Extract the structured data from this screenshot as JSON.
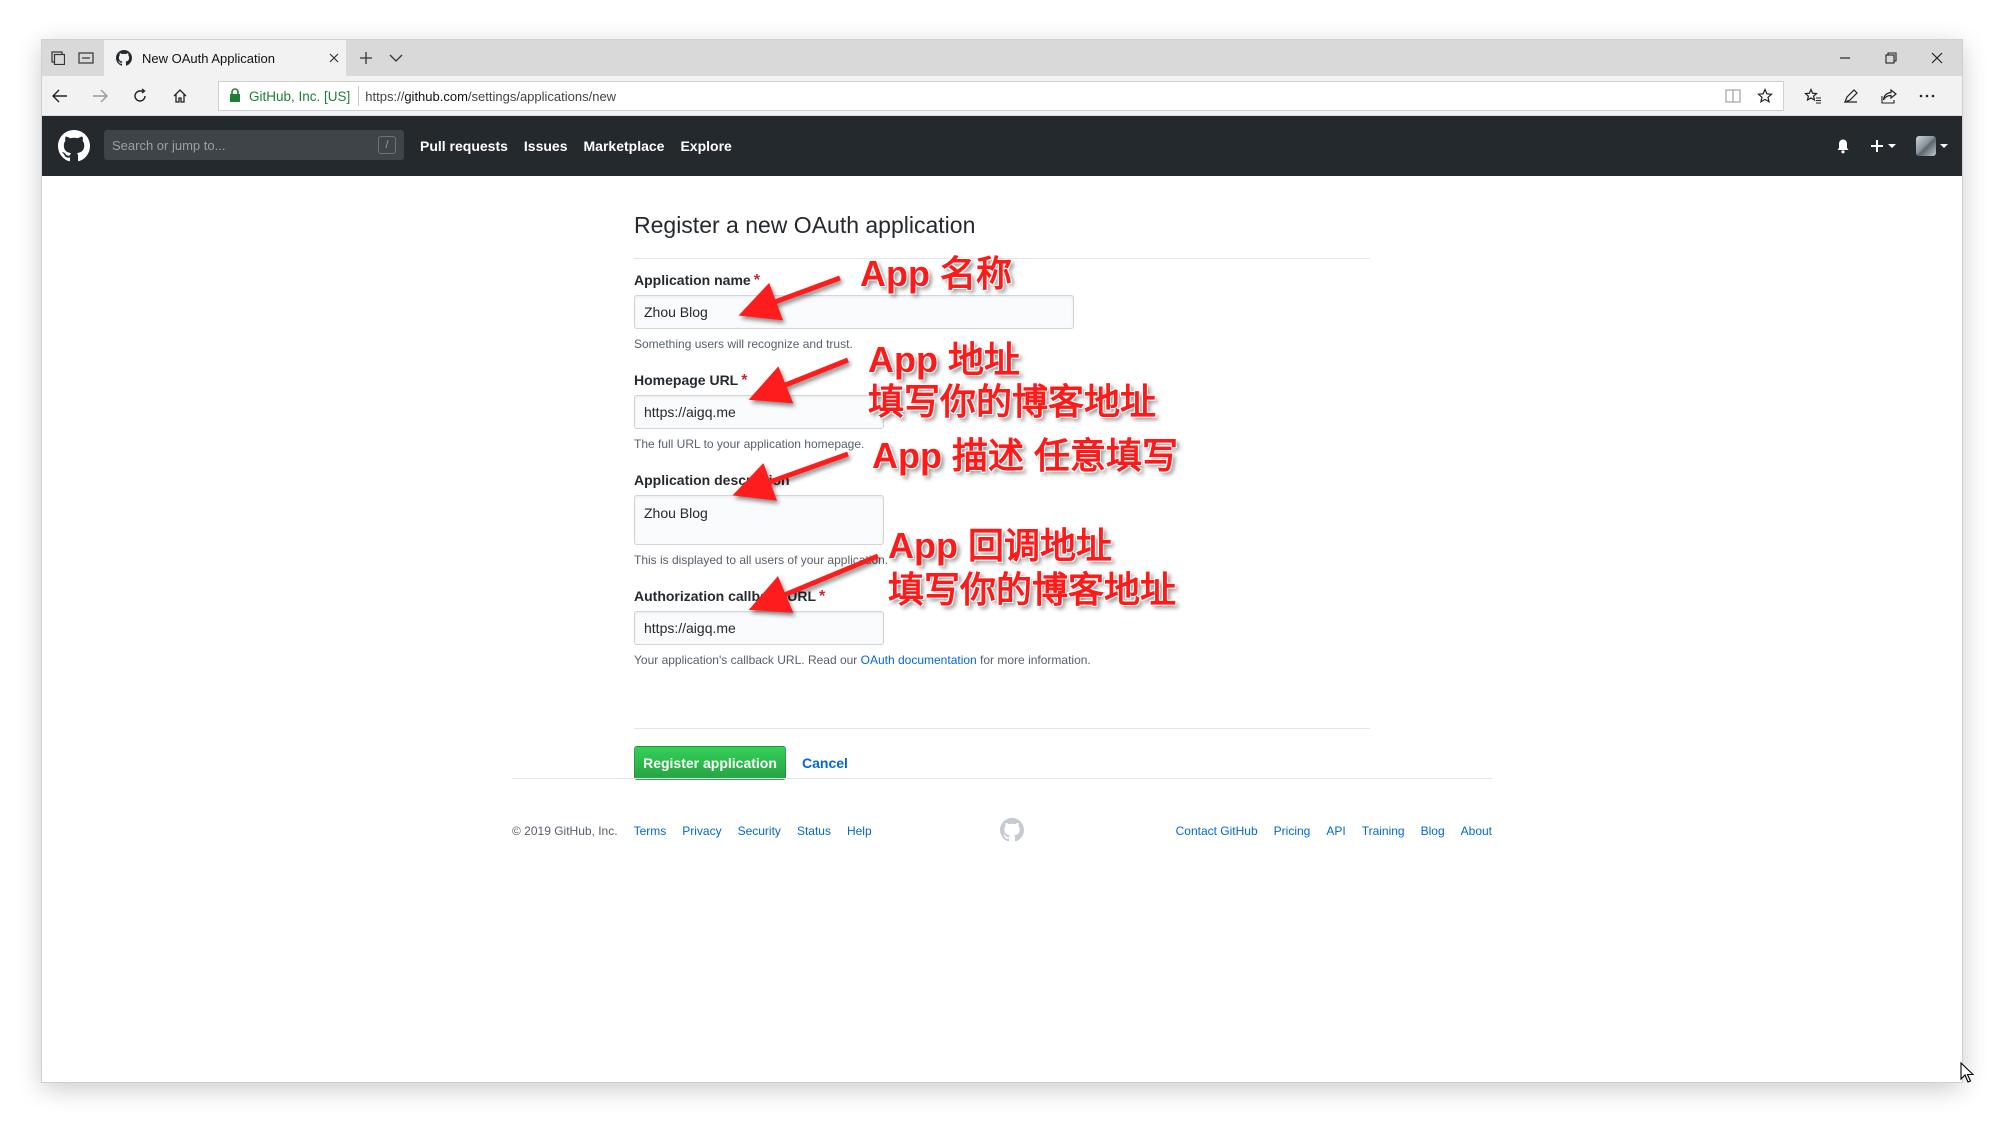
{
  "browser": {
    "tab_title": "New OAuth Application",
    "cert_label": "GitHub, Inc. [US]",
    "url_prefix": "https://",
    "url_domain": "github.com",
    "url_path": "/settings/applications/new"
  },
  "header": {
    "search_placeholder": "Search or jump to...",
    "search_shortcut": "/",
    "nav": [
      "Pull requests",
      "Issues",
      "Marketplace",
      "Explore"
    ]
  },
  "form": {
    "title": "Register a new OAuth application",
    "required_mark": "*",
    "app_name": {
      "label": "Application name",
      "value": "Zhou Blog",
      "note": "Something users will recognize and trust."
    },
    "homepage": {
      "label": "Homepage URL",
      "value": "https://aigq.me",
      "note": "The full URL to your application homepage."
    },
    "description": {
      "label": "Application description",
      "value": "Zhou Blog",
      "note": "This is displayed to all users of your application."
    },
    "callback": {
      "label": "Authorization callback URL",
      "value": "https://aigq.me",
      "note_prefix": "Your application's callback URL. Read our ",
      "note_link": "OAuth documentation",
      "note_suffix": " for more information."
    },
    "register_button": "Register application",
    "cancel_link": "Cancel"
  },
  "footer": {
    "copyright": "© 2019 GitHub, Inc.",
    "left_links": [
      "Terms",
      "Privacy",
      "Security",
      "Status",
      "Help"
    ],
    "right_links": [
      "Contact GitHub",
      "Pricing",
      "API",
      "Training",
      "Blog",
      "About"
    ]
  },
  "annotations": {
    "name": "App 名称",
    "homepage_1": "App 地址",
    "homepage_2": "填写你的博客地址",
    "description": "App 描述 任意填写",
    "callback_1": "App 回调地址",
    "callback_2": "填写你的博客地址"
  },
  "colors": {
    "header_bg": "#24292e",
    "button_green": "#28a745",
    "link_blue": "#0366d6",
    "required_red": "#cb2431",
    "annotation_red": "#ff1a1a"
  },
  "icons": [
    "tab-actions-icon",
    "tab-preview-icon",
    "github-favicon-icon",
    "close-icon",
    "new-tab-icon",
    "chevron-down-icon",
    "minimize-icon",
    "restore-icon",
    "back-icon",
    "forward-icon",
    "refresh-icon",
    "home-icon",
    "lock-icon",
    "reading-view-icon",
    "star-icon",
    "favorites-icon",
    "pen-icon",
    "share-icon",
    "more-icon",
    "github-logo-icon",
    "bell-icon",
    "plus-icon"
  ]
}
